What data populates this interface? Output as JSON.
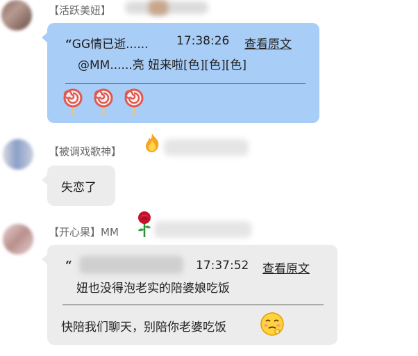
{
  "messages": [
    {
      "sender_tag": "【活跃美妞】",
      "quote": {
        "author": "GG情已逝......",
        "time": "17:38:26",
        "view_link": "查看原文",
        "text": "@MM......亮 妞来啦[色][色][色]"
      },
      "emoji": [
        "lollipop-icon",
        "lollipop-icon",
        "lollipop-icon"
      ]
    },
    {
      "sender_tag": "【被调戏歌神】",
      "badge_icon": "flame-icon",
      "text": "失恋了"
    },
    {
      "sender_tag": "【开心果】MM",
      "badge_icon": "rose-icon",
      "quote": {
        "time": "17:37:52",
        "view_link": "查看原文",
        "text": "妞也没得泡老实的陪婆娘吃饭"
      },
      "text": "快陪我们聊天，别陪你老婆吃饭",
      "emoji": "embarrassed-face-icon"
    }
  ],
  "colors": {
    "blue_bubble": "#a8cdf7",
    "grey_bubble": "#ececec",
    "tag_text": "#666666"
  }
}
